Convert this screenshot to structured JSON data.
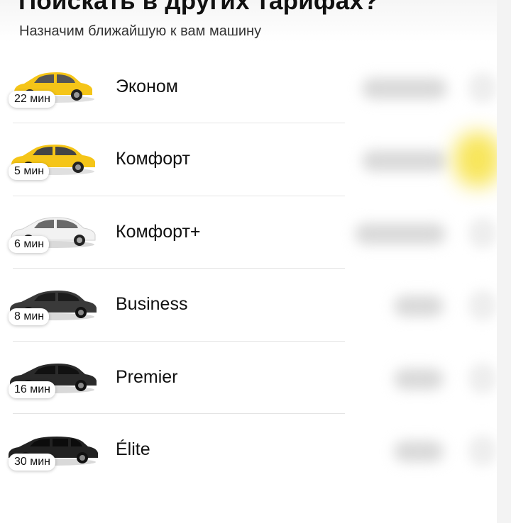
{
  "header": {
    "title": "Поискать в других тарифах?",
    "subtitle": "Назначим ближайшую к вам машину"
  },
  "tariffs": [
    {
      "name": "Эконом",
      "eta": "22 мин",
      "car_color": "#f5c518",
      "car_icon": "yellow-sedan-icon"
    },
    {
      "name": "Комфорт",
      "eta": "5 мин",
      "car_color": "#f5c518",
      "car_icon": "yellow-sedan-icon"
    },
    {
      "name": "Комфорт+",
      "eta": "6 мин",
      "car_color": "#f2f2f2",
      "car_icon": "white-sedan-icon"
    },
    {
      "name": "Business",
      "eta": "8 мин",
      "car_color": "#3a3a3a",
      "car_icon": "dark-sedan-icon"
    },
    {
      "name": "Premier",
      "eta": "16 мин",
      "car_color": "#2a2a2a",
      "car_icon": "black-sedan-icon"
    },
    {
      "name": "Élite",
      "eta": "30 мин",
      "car_color": "#222222",
      "car_icon": "black-limousine-icon"
    }
  ],
  "colors": {
    "accent_yellow": "#f7e34a",
    "separator": "#e4e4e4"
  }
}
